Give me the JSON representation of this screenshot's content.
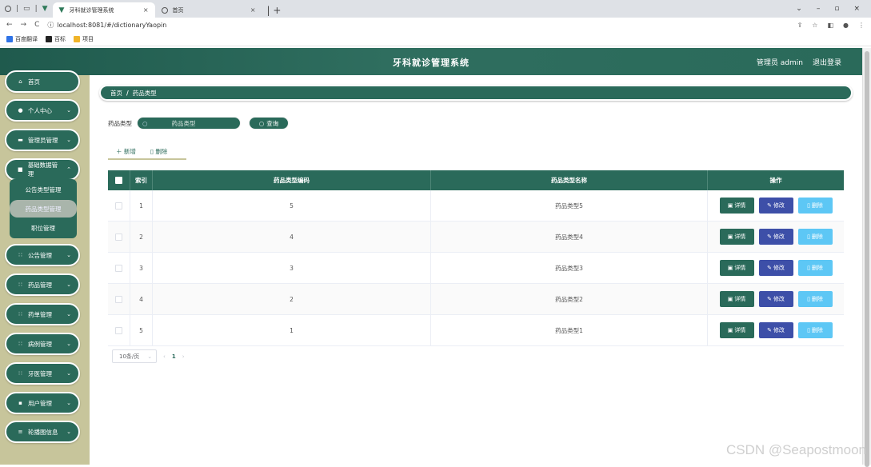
{
  "browser": {
    "tabs": [
      {
        "title": "牙科就诊管理系统",
        "active": true
      },
      {
        "title": "首页",
        "active": false
      }
    ],
    "url": "localhost:8081/#/dictionaryYaopin",
    "bookmarks": [
      {
        "label": "百度翻译",
        "color": "#2f73e6"
      },
      {
        "label": "百标",
        "color": "#222222"
      },
      {
        "label": "项目",
        "color": "#f0b429"
      }
    ]
  },
  "header": {
    "title": "牙科就诊管理系统",
    "user_label": "管理员 admin",
    "logout_label": "退出登录"
  },
  "sidebar": {
    "items": [
      {
        "label": "首页",
        "icon": "home-icon",
        "glyph": "⌂",
        "has_chevron": false
      },
      {
        "label": "个人中心",
        "icon": "user-icon",
        "glyph": "●",
        "has_chevron": true
      },
      {
        "label": "管理员管理",
        "icon": "monitor-icon",
        "glyph": "▬",
        "has_chevron": true
      },
      {
        "label": "基础数据管理",
        "icon": "grid-icon",
        "glyph": "■",
        "has_chevron": true
      },
      {
        "label": "公告管理",
        "icon": "apps-icon",
        "glyph": "∷",
        "has_chevron": true
      },
      {
        "label": "药品管理",
        "icon": "apps-icon",
        "glyph": "∷",
        "has_chevron": true
      },
      {
        "label": "药单管理",
        "icon": "apps-icon",
        "glyph": "∷",
        "has_chevron": true
      },
      {
        "label": "病例管理",
        "icon": "apps-icon",
        "glyph": "∷",
        "has_chevron": true
      },
      {
        "label": "牙医管理",
        "icon": "apps-icon",
        "glyph": "∷",
        "has_chevron": true
      },
      {
        "label": "用户管理",
        "icon": "lock-icon",
        "glyph": "▪",
        "has_chevron": true
      },
      {
        "label": "轮播图信息",
        "icon": "menu-icon",
        "glyph": "≡",
        "has_chevron": true
      }
    ],
    "submenu": [
      {
        "label": "公告类型管理",
        "active": false
      },
      {
        "label": "药品类型管理",
        "active": true
      },
      {
        "label": "职位管理",
        "active": false
      }
    ]
  },
  "breadcrumb": {
    "home": "首页",
    "separator": "/",
    "current": "药品类型"
  },
  "search": {
    "label": "药品类型",
    "placeholder": "药品类型",
    "query_button": "查询"
  },
  "actions": {
    "add": "新增",
    "delete": "删除"
  },
  "table": {
    "columns": [
      "索引",
      "药品类型编码",
      "药品类型名称",
      "操作"
    ],
    "rows": [
      {
        "index": "1",
        "code": "5",
        "name": "药品类型5"
      },
      {
        "index": "2",
        "code": "4",
        "name": "药品类型4"
      },
      {
        "index": "3",
        "code": "3",
        "name": "药品类型3"
      },
      {
        "index": "4",
        "code": "2",
        "name": "药品类型2"
      },
      {
        "index": "5",
        "code": "1",
        "name": "药品类型1"
      }
    ],
    "row_buttons": {
      "detail": "详情",
      "edit": "修改",
      "delete": "删除"
    }
  },
  "pagination": {
    "page_size": "10条/页",
    "current_page": "1"
  },
  "watermark": "CSDN @Seapostmoon",
  "colors": {
    "primary": "#2a6a5a",
    "sidebar_bg": "#c7c59b",
    "edit": "#3d4fa8",
    "delete": "#5dc7f5"
  }
}
